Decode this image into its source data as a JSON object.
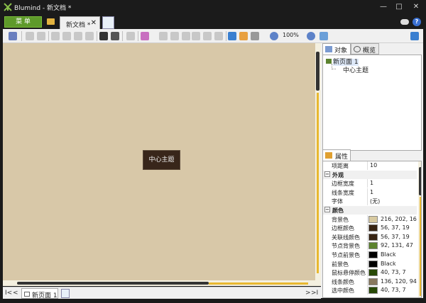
{
  "window": {
    "title": "Blumind - 新文档 *"
  },
  "menubar": {
    "menu_label": "菜 单",
    "doc_tab": "新文档 *",
    "close_glyph": "✕"
  },
  "toolbar": {
    "zoom": "100%"
  },
  "canvas": {
    "topic": "中心主题",
    "background": "#d8c8a8"
  },
  "pagebar": {
    "first": "I<",
    "prev": "<",
    "page_tab": "新页面 1",
    "next": ">",
    "last": ">I"
  },
  "sidebar": {
    "tab_objects": "对象",
    "tab_overview": "概览",
    "tree": {
      "page": "新页面 1",
      "topic": "中心主题"
    },
    "tab_properties": "属性"
  },
  "properties": {
    "rows": [
      {
        "type": "prop",
        "name": "项距离",
        "value": "10"
      },
      {
        "type": "cat",
        "name": "外观",
        "toggle": "−"
      },
      {
        "type": "prop",
        "name": "边框宽度",
        "value": "1"
      },
      {
        "type": "prop",
        "name": "线条宽度",
        "value": "1"
      },
      {
        "type": "prop",
        "name": "字体",
        "value": "(无)"
      },
      {
        "type": "cat",
        "name": "颜色",
        "toggle": "−"
      },
      {
        "type": "color",
        "name": "背景色",
        "value": "216, 202, 16",
        "swatch": "#d8ca a0"
      },
      {
        "type": "color",
        "name": "边框颜色",
        "value": "56, 37, 19",
        "swatch": "#382513"
      },
      {
        "type": "color",
        "name": "关联线颜色",
        "value": "56, 37, 19",
        "swatch": "#382513"
      },
      {
        "type": "color",
        "name": "节点背景色",
        "value": "92, 131, 47",
        "swatch": "#5c832f"
      },
      {
        "type": "color",
        "name": "节点前景色",
        "value": "Black",
        "swatch": "#000000"
      },
      {
        "type": "color",
        "name": "前景色",
        "value": "Black",
        "swatch": "#000000"
      },
      {
        "type": "color",
        "name": "鼠标悬停颜色",
        "value": "40, 73, 7",
        "swatch": "#284907"
      },
      {
        "type": "color",
        "name": "线条颜色",
        "value": "136, 120, 94",
        "swatch": "#88785e"
      },
      {
        "type": "color",
        "name": "选中颜色",
        "value": "40, 73, 7",
        "swatch": "#284907"
      }
    ]
  }
}
